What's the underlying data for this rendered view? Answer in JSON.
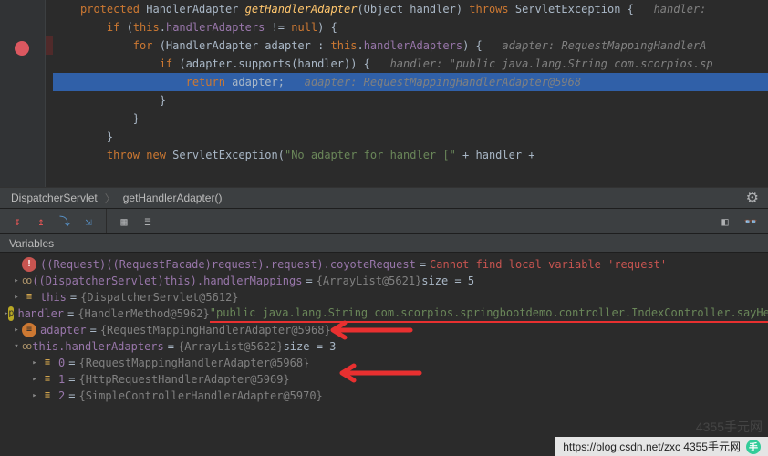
{
  "editor": {
    "lines": [
      {
        "segments": [
          {
            "t": "protected ",
            "c": "kw"
          },
          {
            "t": "HandlerAdapter ",
            "c": "type"
          },
          {
            "t": "getHandlerAdapter",
            "c": "method"
          },
          {
            "t": "(Object handler) ",
            "c": "plain"
          },
          {
            "t": "throws ",
            "c": "kw"
          },
          {
            "t": "ServletException {   ",
            "c": "plain"
          },
          {
            "t": "handler:",
            "c": "comment"
          }
        ],
        "indent": 0
      },
      {
        "segments": [
          {
            "t": "if ",
            "c": "kw"
          },
          {
            "t": "(",
            "c": "plain"
          },
          {
            "t": "this",
            "c": "kw"
          },
          {
            "t": ".",
            "c": "plain"
          },
          {
            "t": "handlerAdapters",
            "c": "this-kw"
          },
          {
            "t": " != ",
            "c": "plain"
          },
          {
            "t": "null",
            "c": "kw"
          },
          {
            "t": ") {",
            "c": "plain"
          }
        ],
        "indent": 1
      },
      {
        "segments": [
          {
            "t": "for ",
            "c": "kw"
          },
          {
            "t": "(HandlerAdapter adapter : ",
            "c": "plain"
          },
          {
            "t": "this",
            "c": "kw"
          },
          {
            "t": ".",
            "c": "plain"
          },
          {
            "t": "handlerAdapters",
            "c": "this-kw"
          },
          {
            "t": ") {   ",
            "c": "plain"
          },
          {
            "t": "adapter: RequestMappingHandlerA",
            "c": "comment"
          }
        ],
        "indent": 2,
        "bp": true
      },
      {
        "segments": [
          {
            "t": "if ",
            "c": "kw"
          },
          {
            "t": "(adapter.supports(handler)) {   ",
            "c": "plain"
          },
          {
            "t": "handler: \"public java.lang.String com.scorpios.sp",
            "c": "comment"
          }
        ],
        "indent": 3
      },
      {
        "segments": [
          {
            "t": "return ",
            "c": "kw"
          },
          {
            "t": "adapter;   ",
            "c": "plain"
          },
          {
            "t": "adapter: RequestMappingHandlerAdapter@5968",
            "c": "comment"
          }
        ],
        "indent": 4,
        "highlight": true
      },
      {
        "segments": [
          {
            "t": "}",
            "c": "plain"
          }
        ],
        "indent": 3
      },
      {
        "segments": [
          {
            "t": "}",
            "c": "plain"
          }
        ],
        "indent": 2
      },
      {
        "segments": [
          {
            "t": "}",
            "c": "plain"
          }
        ],
        "indent": 1
      },
      {
        "segments": [
          {
            "t": "throw new ",
            "c": "kw"
          },
          {
            "t": "ServletException(",
            "c": "plain"
          },
          {
            "t": "\"No adapter for handler [\"",
            "c": "str"
          },
          {
            "t": " + handler +",
            "c": "plain"
          }
        ],
        "indent": 1
      }
    ]
  },
  "breadcrumb": {
    "class": "DispatcherServlet",
    "method": "getHandlerAdapter()"
  },
  "panel": {
    "title": "Variables"
  },
  "variables": [
    {
      "depth": 0,
      "twisty": "",
      "icon": "err",
      "name": "((Request)((RequestFacade)request).request).coyoteRequest",
      "errText": "Cannot find local variable 'request'"
    },
    {
      "depth": 0,
      "twisty": "▸",
      "oo": true,
      "name": "((DispatcherServlet)this).handlerMappings",
      "dim": "{ArrayList@5621}",
      "val": " size = 5"
    },
    {
      "depth": 0,
      "twisty": "▸",
      "icon": "obj",
      "name": "this",
      "dim": "{DispatcherServlet@5612}"
    },
    {
      "depth": 0,
      "twisty": "▸",
      "icon": "param",
      "name": "handler",
      "dim": "{HandlerMethod@5962}",
      "str": "\"public java.lang.String com.scorpios.springbootdemo.controller.IndexController.sayHello()\"",
      "underline": true
    },
    {
      "depth": 0,
      "twisty": "▸",
      "icon": "var",
      "name": "adapter",
      "dim": "{RequestMappingHandlerAdapter@5968}"
    },
    {
      "depth": 0,
      "twisty": "▾",
      "oo": true,
      "name": "this.handlerAdapters",
      "dim": "{ArrayList@5622}",
      "val": " size = 3"
    },
    {
      "depth": 1,
      "twisty": "▸",
      "icon": "obj",
      "name": "0",
      "dim": "{RequestMappingHandlerAdapter@5968}"
    },
    {
      "depth": 1,
      "twisty": "▸",
      "icon": "obj",
      "name": "1",
      "dim": "{HttpRequestHandlerAdapter@5969}"
    },
    {
      "depth": 1,
      "twisty": "▸",
      "icon": "obj",
      "name": "2",
      "dim": "{SimpleControllerHandlerAdapter@5970}"
    }
  ],
  "footer": {
    "url": "https://blog.csdn.net/zxc  4355手元网"
  }
}
